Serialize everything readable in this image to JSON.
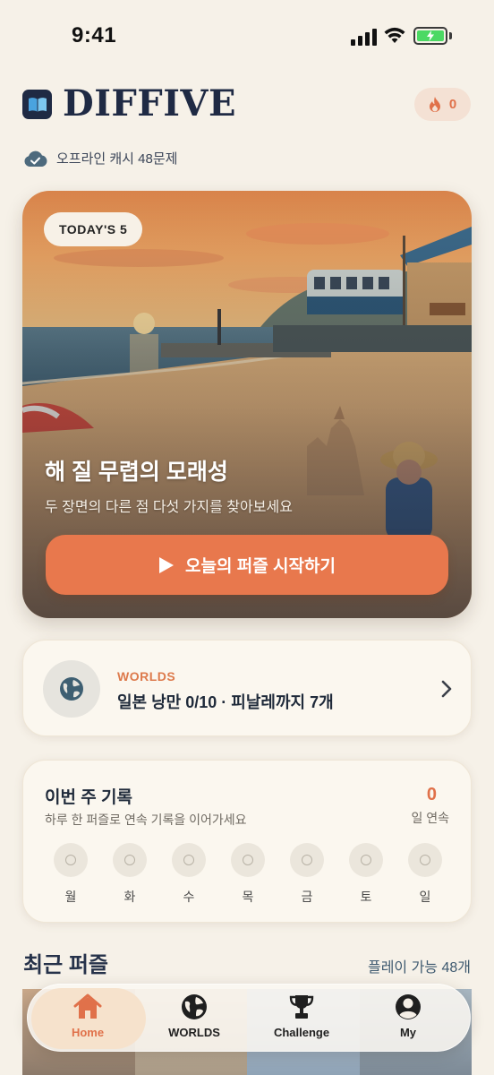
{
  "status_bar": {
    "time": "9:41"
  },
  "header": {
    "title": "DIFFIVE",
    "streak_count": "0"
  },
  "offline": {
    "label": "오프라인 캐시 48문제"
  },
  "hero": {
    "badge": "TODAY'S 5",
    "title": "해 질 무렵의 모래성",
    "subtitle": "두 장면의 다른 점 다섯 가지를 찾아보세요",
    "button_label": "오늘의 퍼즐 시작하기"
  },
  "worlds": {
    "label": "WORLDS",
    "progress": "일본 낭만 0/10 · 피날레까지 7개"
  },
  "weekly": {
    "title": "이번 주 기록",
    "subtitle": "하루 한 퍼즐로 연속 기록을 이어가세요",
    "streak_number": "0",
    "streak_unit": "일 연속",
    "days": [
      "월",
      "화",
      "수",
      "목",
      "금",
      "토",
      "일"
    ]
  },
  "recent": {
    "title": "최근 퍼즐",
    "count": "플레이 가능 48개"
  },
  "tabs": [
    {
      "label": "Home",
      "icon": "home-icon",
      "active": true
    },
    {
      "label": "WORLDS",
      "icon": "globe-icon",
      "active": false
    },
    {
      "label": "Challenge",
      "icon": "trophy-icon",
      "active": false
    },
    {
      "label": "My",
      "icon": "profile-icon",
      "active": false
    }
  ],
  "colors": {
    "accent": "#e8784d",
    "navy": "#1f2a44",
    "background": "#f6f1e8"
  }
}
